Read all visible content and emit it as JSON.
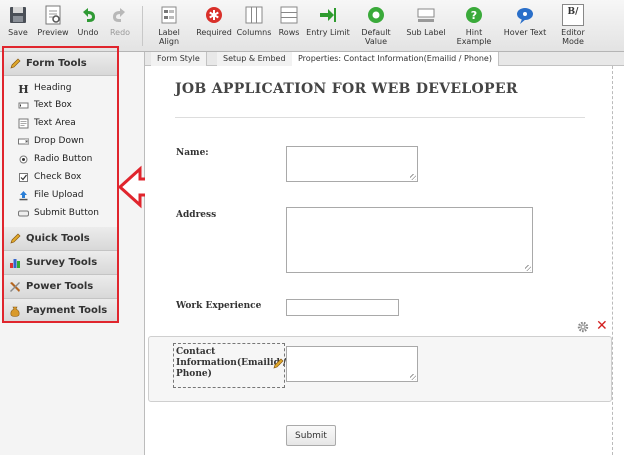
{
  "toolbar": {
    "save": "Save",
    "preview": "Preview",
    "undo": "Undo",
    "redo": "Redo",
    "label_align": "Label Align",
    "required": "Required",
    "columns": "Columns",
    "rows": "Rows",
    "entry_limit": "Entry Limit",
    "default_value_1": "Default",
    "default_value_2": "Value",
    "sub_label": "Sub Label",
    "hint_example_1": "Hint",
    "hint_example_2": "Example",
    "hover_text": "Hover Text",
    "editor_mode": "Editor Mode",
    "editor_mode_glyph": "B/"
  },
  "sidebar": {
    "form_tools": "Form Tools",
    "tools": [
      "Heading",
      "Text Box",
      "Text Area",
      "Drop Down",
      "Radio Button",
      "Check Box",
      "File Upload",
      "Submit Button"
    ],
    "quick_tools": "Quick Tools",
    "survey_tools": "Survey Tools",
    "power_tools": "Power Tools",
    "payment_tools": "Payment Tools"
  },
  "tabs": {
    "form_style": "Form Style",
    "setup_embed": "Setup & Embed",
    "properties": "Properties: Contact Information(Emailid / Phone)"
  },
  "form": {
    "title": "JOB APPLICATION FOR WEB DEVELOPER",
    "name_label": "Name:",
    "address_label": "Address",
    "work_experience_label": "Work Experience",
    "contact_label_1": "Contact",
    "contact_label_2": "Information(Emailid /",
    "contact_label_3": "Phone)",
    "submit": "Submit",
    "close_glyph": "✕"
  },
  "colors": {
    "accent_red": "#e0252d",
    "required_red": "#d9302a",
    "entry_green": "#2e9b2e",
    "hover_blue": "#2a6fc9"
  }
}
